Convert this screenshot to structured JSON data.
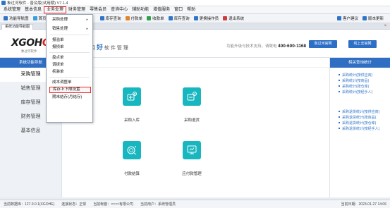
{
  "titlebar": {
    "title": "象过河软件 - 普及版(试用期) V7.1.4"
  },
  "menubar": {
    "items": [
      "系统管理",
      "基本信息",
      "业务处理",
      "财务管理",
      "零售会员",
      "查询中心",
      "辅助功能",
      "增值服务",
      "窗口",
      "帮助"
    ],
    "active": "业务处理"
  },
  "toolbar": {
    "items": [
      "功能导航图",
      "首页",
      "库存查询",
      "付款单",
      "收款单",
      "库存查询",
      "更换操作员",
      "退出系统"
    ],
    "right_items": [
      "客户建议",
      "版本更新"
    ],
    "icon_colors": [
      "#2e74c9",
      "#3aa0e0",
      "#2e74c9",
      "#e0832e",
      "#2fa04a",
      "#2e74c9",
      "#2e74c9",
      "#d03a3a",
      "#2e74c9",
      "#2e74c9"
    ]
  },
  "tabbar": {
    "tab": "系统功能导航图",
    "close": "×"
  },
  "header": {
    "logo_main": "XGOH",
    "logo_end": "O",
    "logo_sub": "象过河软件",
    "slogan_pre": "好",
    "slogan_mid": "用",
    "slogan_post": "软 件 管 理",
    "slogan_lead": "",
    "hotline_text": "功能升级与技术支持，请致电",
    "hotline_number": "400-600-1168",
    "btn_site": "象过河官网",
    "btn_buy": "线上去官网"
  },
  "sidebar": {
    "head": "系统功能导航",
    "items": [
      "采购管理",
      "销售管理",
      "库存管理",
      "财务管理",
      "基本信息"
    ],
    "active": "采购管理"
  },
  "content": {
    "tiles": [
      {
        "label": "采购入库",
        "icon": "purchase-in-icon"
      },
      {
        "label": "采购退货",
        "icon": "purchase-return-icon"
      },
      {
        "label": "付款结算",
        "icon": "payment-settle-icon"
      },
      {
        "label": "应付款管理",
        "icon": "payables-icon"
      }
    ],
    "tile_color": "#18b7bf"
  },
  "rightpane": {
    "head": "相关查询统计",
    "group1": [
      "采购统计(按供应商)",
      "采购统计(按商品)",
      "采购统计(按仓库)",
      "采购统计(按经手人)"
    ],
    "group2": [
      "采购退货统计(按供应商)",
      "采购退货统计(按商品)",
      "采购退货统计(按仓库)",
      "采购退货统计(按经手人)"
    ]
  },
  "statusbar": {
    "items": [
      "当前数据库：127.0.0.1(XGOHE)",
      "连接状态：正常",
      "当前帐套：××××有限公司",
      "当前用户：系统管理员"
    ],
    "right": "当前日期：2023-01-27 14:06"
  },
  "dropdown": {
    "items": [
      "采购处理",
      "销售处理",
      "报溢单",
      "报损单",
      "盘点单",
      "调拨单",
      "拆装单",
      "成本调整单",
      "库存上下限设置",
      "期末结存(月结存)"
    ],
    "has_submenu": [
      "采购处理",
      "销售处理"
    ],
    "highlighted": "库存上下限设置",
    "arrow": "▸"
  },
  "colors": {
    "accent": "#2f6ec2",
    "highlight": "#e5252a",
    "tile": "#18b7bf"
  }
}
